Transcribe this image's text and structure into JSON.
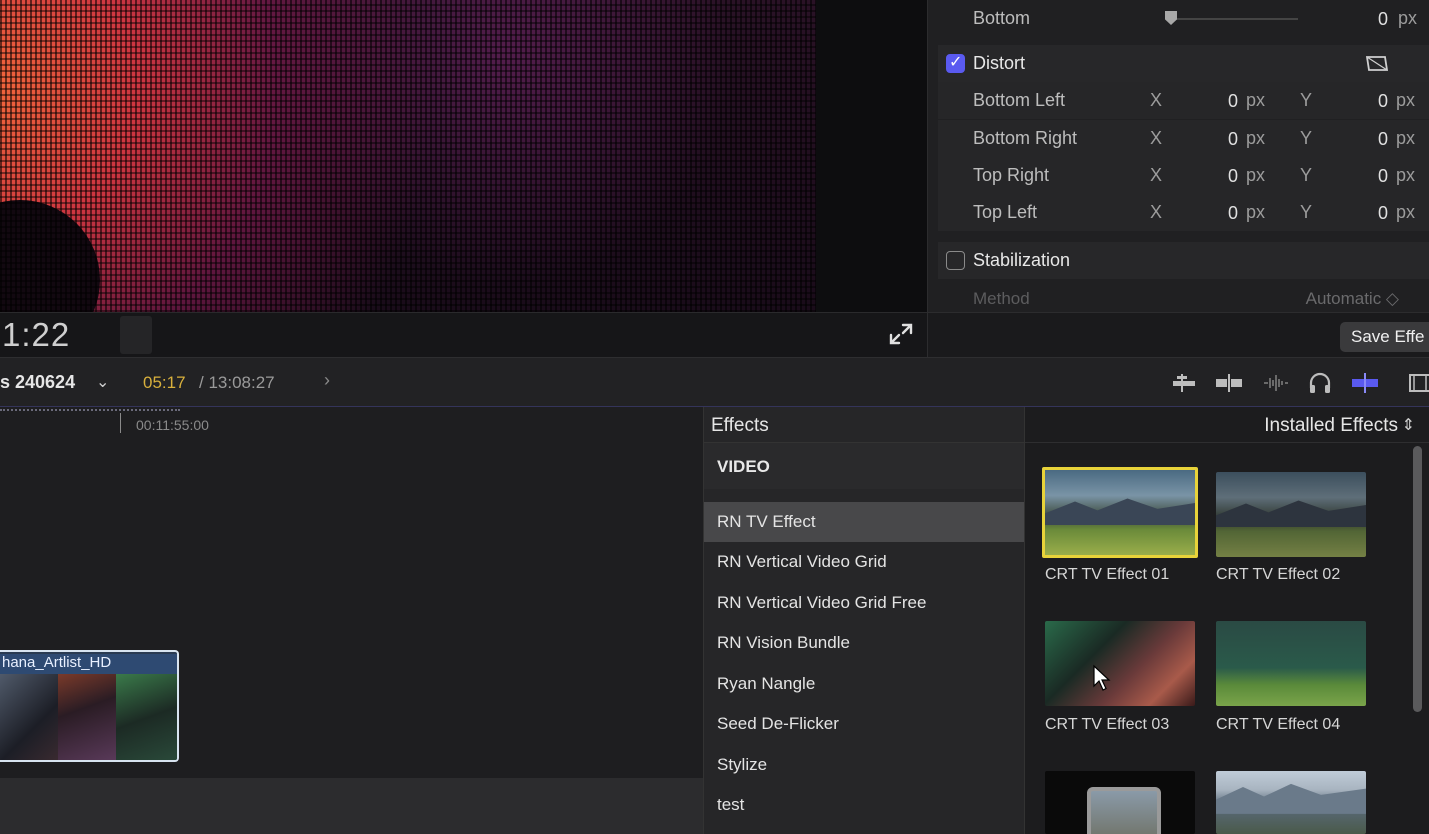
{
  "viewer": {
    "timecode": "1:22"
  },
  "inspector": {
    "bottom_row": {
      "label": "Bottom",
      "value": "0",
      "unit": "px"
    },
    "distort": {
      "label": "Distort",
      "checked": true,
      "rows": [
        {
          "label": "Bottom Left",
          "x_label": "X",
          "x_value": "0",
          "x_unit": "px",
          "y_label": "Y",
          "y_value": "0",
          "y_unit": "px"
        },
        {
          "label": "Bottom Right",
          "x_label": "X",
          "x_value": "0",
          "x_unit": "px",
          "y_label": "Y",
          "y_value": "0",
          "y_unit": "px"
        },
        {
          "label": "Top Right",
          "x_label": "X",
          "x_value": "0",
          "x_unit": "px",
          "y_label": "Y",
          "y_value": "0",
          "y_unit": "px"
        },
        {
          "label": "Top Left",
          "x_label": "X",
          "x_value": "0",
          "x_unit": "px",
          "y_label": "Y",
          "y_value": "0",
          "y_unit": "px"
        }
      ]
    },
    "stabilization": {
      "label": "Stabilization",
      "checked": false
    },
    "method": {
      "label": "Method",
      "value": "Automatic ◇"
    },
    "save_button": "Save Effe"
  },
  "timeline_header": {
    "project_name": "s 240624",
    "chevron": "⌄",
    "timecode_current": "05:17",
    "timecode_total": " / 13:08:27",
    "next_arrow": "›"
  },
  "timeline": {
    "ruler_timecode": "00:11:55:00",
    "clip_name": "hana_Artlist_HD"
  },
  "effects": {
    "title": "Effects",
    "category_header": "VIDEO",
    "items": [
      "RN TV Effect",
      "RN Vertical Video Grid",
      "RN Vertical Video Grid Free",
      "RN Vision Bundle",
      "Ryan Nangle",
      "Seed De-Flicker",
      "Stylize",
      "test"
    ],
    "selected_index": 0
  },
  "effects_grid": {
    "source_label": "Installed Effects",
    "source_icon": "⌃⌄",
    "thumbnails": [
      {
        "label": "CRT TV Effect 01",
        "selected": true
      },
      {
        "label": "CRT TV Effect 02",
        "selected": false
      },
      {
        "label": "CRT TV Effect 03",
        "selected": false
      },
      {
        "label": "CRT TV Effect 04",
        "selected": false
      },
      {
        "label": "",
        "selected": false
      },
      {
        "label": "",
        "selected": false
      }
    ]
  },
  "colors": {
    "accent": "#5a5af0",
    "selection_yellow": "#e8d33a",
    "timecode_yellow": "#d8b03c"
  }
}
